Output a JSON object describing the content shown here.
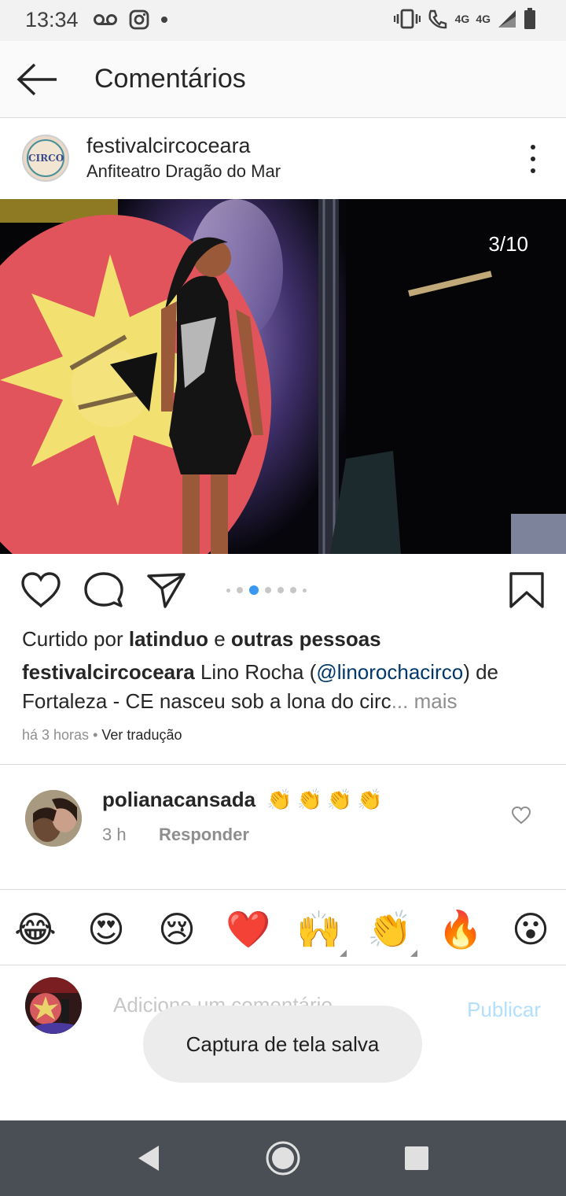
{
  "status_bar": {
    "time": "13:34",
    "left_icons": [
      "voicemail-icon",
      "instagram-icon",
      "notification-dot-icon"
    ],
    "right_icons": [
      "vibrate-icon",
      "wifi-call-icon",
      "signal-icon",
      "battery-icon"
    ],
    "net_label_1": "4G",
    "net_label_2": "4G"
  },
  "header": {
    "title": "Comentários",
    "back_icon": "arrow-left-icon"
  },
  "post": {
    "username": "festivalcircoceara",
    "location": "Anfiteatro Dragão do Mar",
    "avatar_text": "CIRCO",
    "image_counter": "3/10",
    "carousel": {
      "total_dots": 7,
      "active_index": 2
    },
    "likes": {
      "prefix": "Curtido por",
      "user": "latinduo",
      "joiner": "e",
      "others": "outras pessoas"
    },
    "caption": {
      "author": "festivalcircoceara",
      "text_before": "Lino Rocha (",
      "mention": "@linorochacirco",
      "text_after": ") de Fortaleza - CE nasceu sob a lona do circ",
      "ellipsis": "...",
      "more": "mais"
    },
    "time_ago": "há 3 horas",
    "separator": "•",
    "translate": "Ver tradução"
  },
  "comment": {
    "username": "polianacansada",
    "emojis": [
      "👏",
      "👏",
      "👏",
      "👏"
    ],
    "time": "3 h",
    "reply": "Responder"
  },
  "emoji_bar": [
    "😂",
    "😍",
    "😢",
    "❤️",
    "🙌",
    "👏",
    "🔥",
    "😮"
  ],
  "compose": {
    "placeholder": "Adicione um comentário...",
    "publish": "Publicar"
  },
  "toast": "Captura de tela salva",
  "colors": {
    "accent_blue": "#3897f0",
    "publish_disabled": "#b2dffc",
    "mention": "#00376b",
    "muted": "#8e8e8e",
    "nav_bar": "#4a4f55"
  }
}
